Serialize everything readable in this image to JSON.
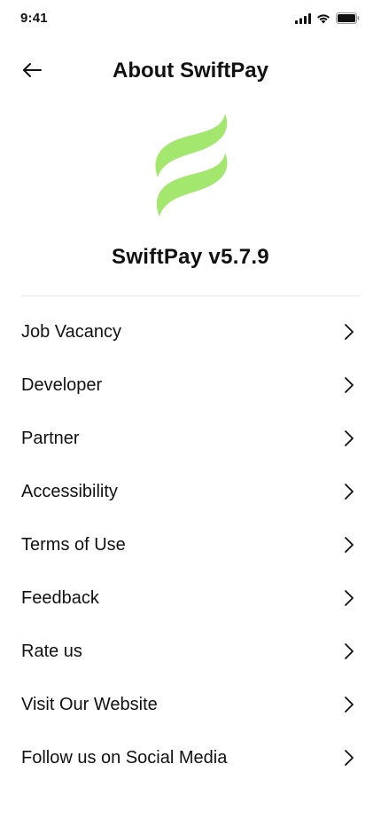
{
  "status_bar": {
    "time": "9:41",
    "icons": [
      "cellular-signal-icon",
      "wifi-icon",
      "battery-icon"
    ]
  },
  "header": {
    "back_icon": "arrow-left-icon",
    "title": "About SwiftPay"
  },
  "logo": {
    "icon": "swiftpay-logo-icon",
    "color": "#A4E76F"
  },
  "app": {
    "version_label": "SwiftPay v5.7.9"
  },
  "menu": {
    "items": [
      {
        "label": "Job Vacancy"
      },
      {
        "label": "Developer"
      },
      {
        "label": "Partner"
      },
      {
        "label": "Accessibility"
      },
      {
        "label": "Terms of Use"
      },
      {
        "label": "Feedback"
      },
      {
        "label": "Rate us"
      },
      {
        "label": "Visit Our Website"
      },
      {
        "label": "Follow us on Social Media"
      }
    ],
    "chevron_icon": "chevron-right-icon"
  },
  "colors": {
    "text": "#111111",
    "divider": "#E6E6E6",
    "accent": "#A4E76F",
    "background": "#FFFFFF"
  }
}
